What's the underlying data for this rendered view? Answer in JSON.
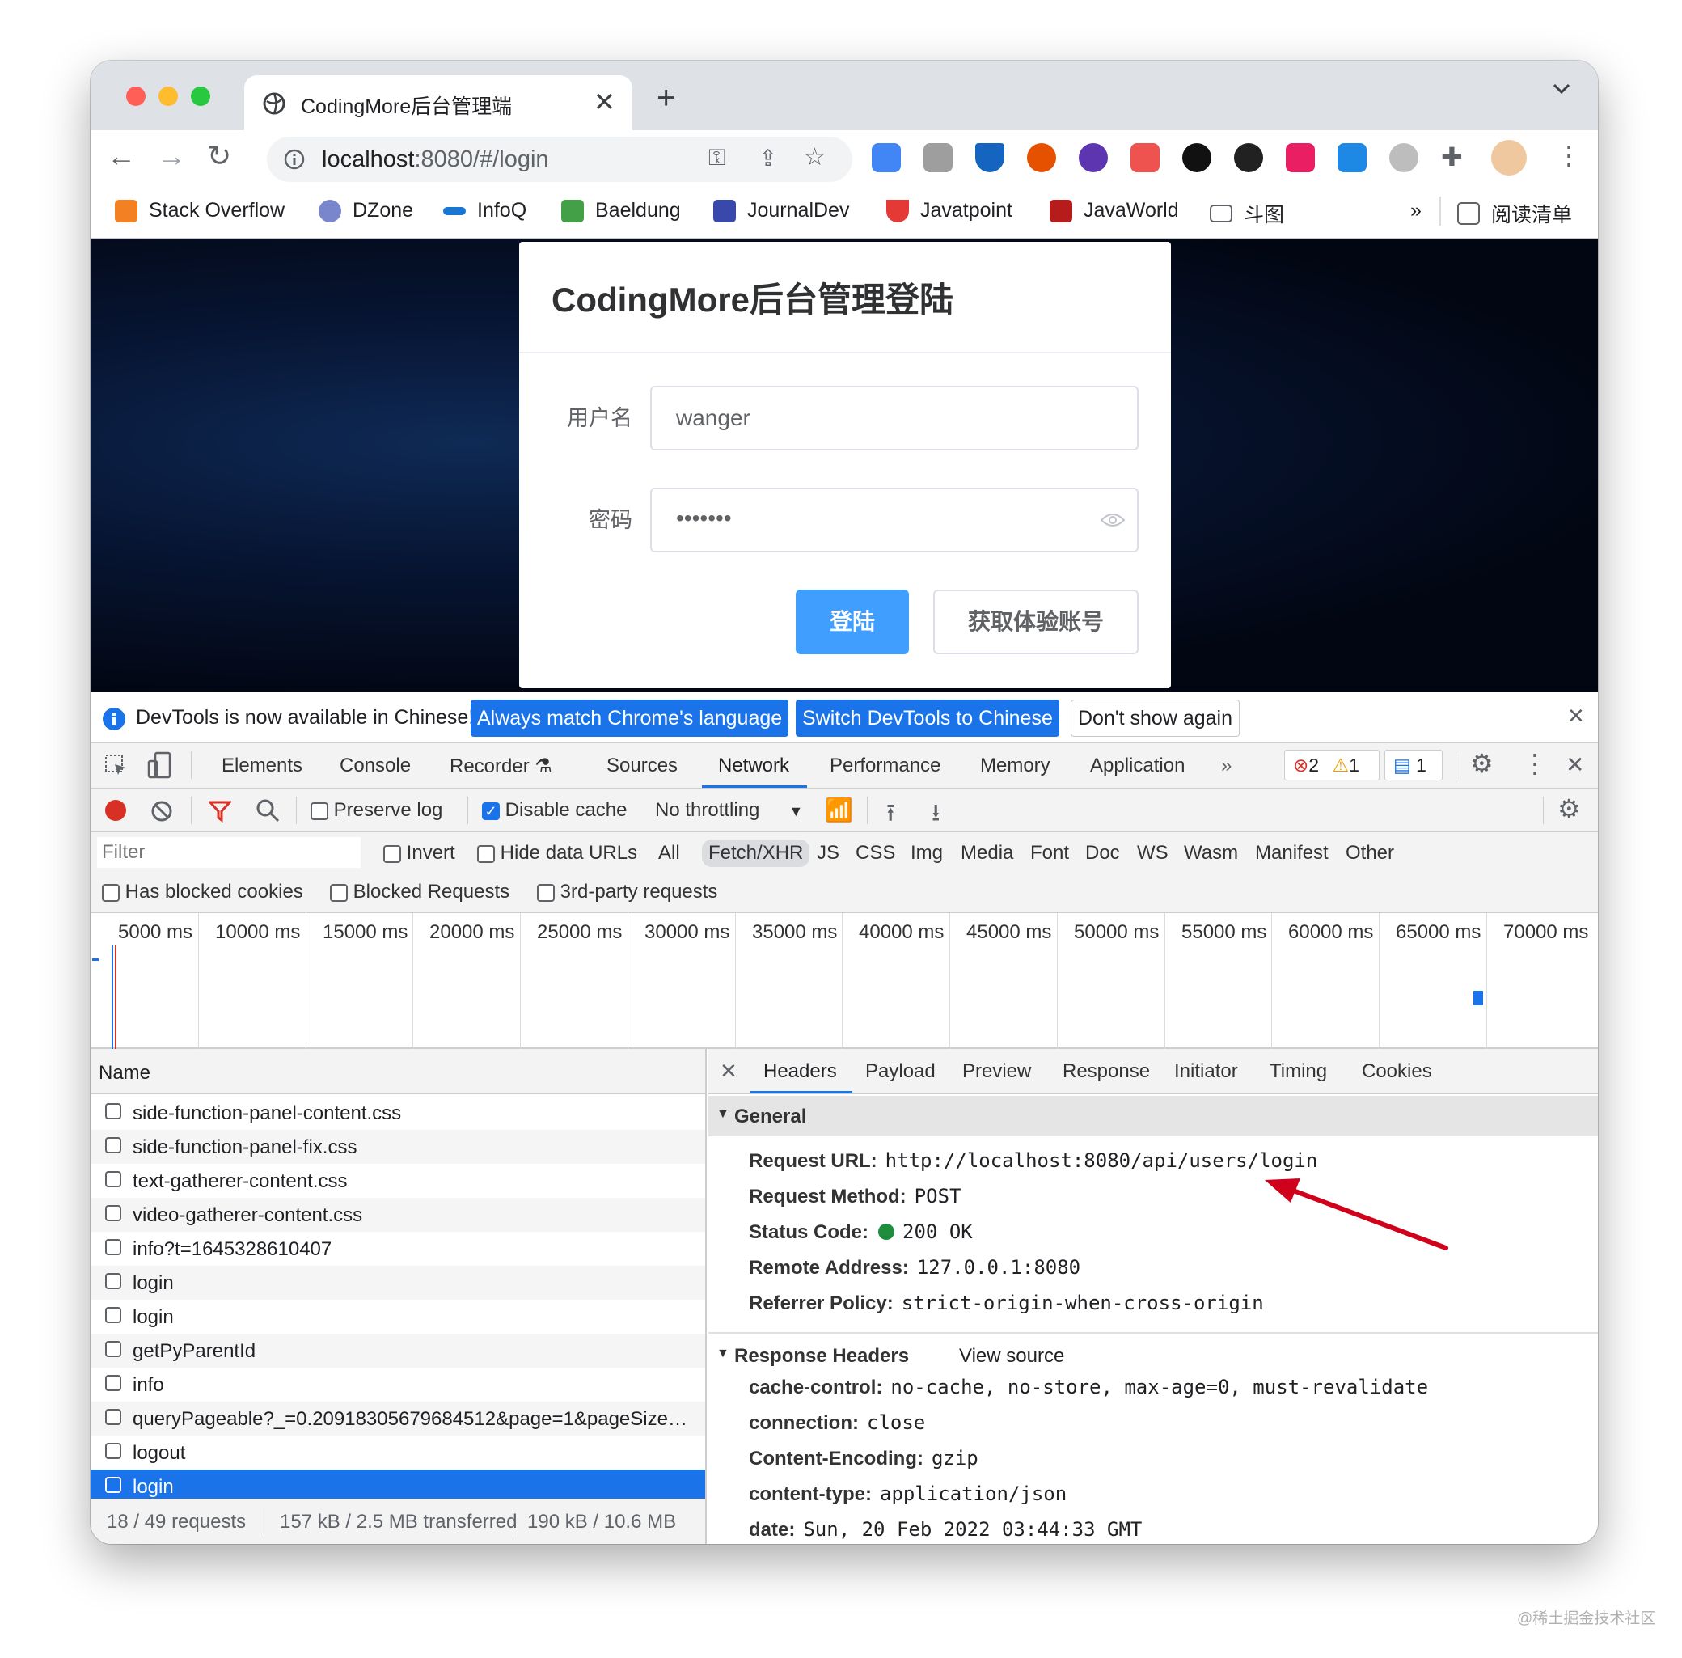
{
  "browser": {
    "tab_title": "CodingMore后台管理端",
    "url_host": "localhost",
    "url_rest": ":8080/#/login",
    "bookmarks": [
      "Stack Overflow",
      "DZone",
      "InfoQ",
      "Baeldung",
      "JournalDev",
      "Javatpoint",
      "JavaWorld",
      "斗图"
    ],
    "more_bookmarks": "»",
    "reading_list": "阅读清单"
  },
  "login": {
    "title": "CodingMore后台管理登陆",
    "username_label": "用户名",
    "username_value": "wanger",
    "password_label": "密码",
    "password_value": "•••••••",
    "login_button": "登陆",
    "trial_button": "获取体验账号"
  },
  "infobar": {
    "message": "DevTools is now available in Chinese!",
    "btn_match": "Always match Chrome's language",
    "btn_switch": "Switch DevTools to Chinese",
    "btn_dont": "Don't show again"
  },
  "devtools": {
    "tabs": [
      "Elements",
      "Console",
      "Recorder",
      "Sources",
      "Network",
      "Performance",
      "Memory",
      "Application"
    ],
    "errors": "2",
    "warnings": "1",
    "messages": "1",
    "preserve_log": "Preserve log",
    "disable_cache": "Disable cache",
    "throttling": "No throttling",
    "filter_placeholder": "Filter",
    "invert": "Invert",
    "hide_data_urls": "Hide data URLs",
    "types": [
      "All",
      "Fetch/XHR",
      "JS",
      "CSS",
      "Img",
      "Media",
      "Font",
      "Doc",
      "WS",
      "Wasm",
      "Manifest",
      "Other"
    ],
    "has_blocked_cookies": "Has blocked cookies",
    "blocked_requests": "Blocked Requests",
    "third_party": "3rd-party requests"
  },
  "timeline": {
    "ticks": [
      "5000 ms",
      "10000 ms",
      "15000 ms",
      "20000 ms",
      "25000 ms",
      "30000 ms",
      "35000 ms",
      "40000 ms",
      "45000 ms",
      "50000 ms",
      "55000 ms",
      "60000 ms",
      "65000 ms",
      "70000 ms"
    ]
  },
  "requests": {
    "header": "Name",
    "rows": [
      "side-function-panel-content.css",
      "side-function-panel-fix.css",
      "text-gatherer-content.css",
      "video-gatherer-content.css",
      "info?t=1645328610407",
      "login",
      "login",
      "getPyParentId",
      "info",
      "queryPageable?_=0.20918305679684512&page=1&pageSize…",
      "logout",
      "login"
    ],
    "status_requests": "18 / 49 requests",
    "status_transferred": "157 kB / 2.5 MB transferred",
    "status_resources": "190 kB / 10.6 MB"
  },
  "detail": {
    "tabs": [
      "Headers",
      "Payload",
      "Preview",
      "Response",
      "Initiator",
      "Timing",
      "Cookies"
    ],
    "general_title": "General",
    "general": [
      {
        "k": "Request URL:",
        "v": "http://localhost:8080/api/users/login"
      },
      {
        "k": "Request Method:",
        "v": "POST"
      },
      {
        "k": "Status Code:",
        "v": "200 OK"
      },
      {
        "k": "Remote Address:",
        "v": "127.0.0.1:8080"
      },
      {
        "k": "Referrer Policy:",
        "v": "strict-origin-when-cross-origin"
      }
    ],
    "response_title": "Response Headers",
    "view_source": "View source",
    "response": [
      {
        "k": "cache-control:",
        "v": "no-cache, no-store, max-age=0, must-revalidate"
      },
      {
        "k": "connection:",
        "v": "close"
      },
      {
        "k": "Content-Encoding:",
        "v": "gzip"
      },
      {
        "k": "content-type:",
        "v": "application/json"
      },
      {
        "k": "date:",
        "v": "Sun, 20 Feb 2022 03:44:33 GMT"
      }
    ]
  },
  "watermark": "@稀土掘金技术社区",
  "colors": {
    "accent": "#1a73e8",
    "primary_button": "#409eff",
    "arrow": "#d0021b"
  }
}
